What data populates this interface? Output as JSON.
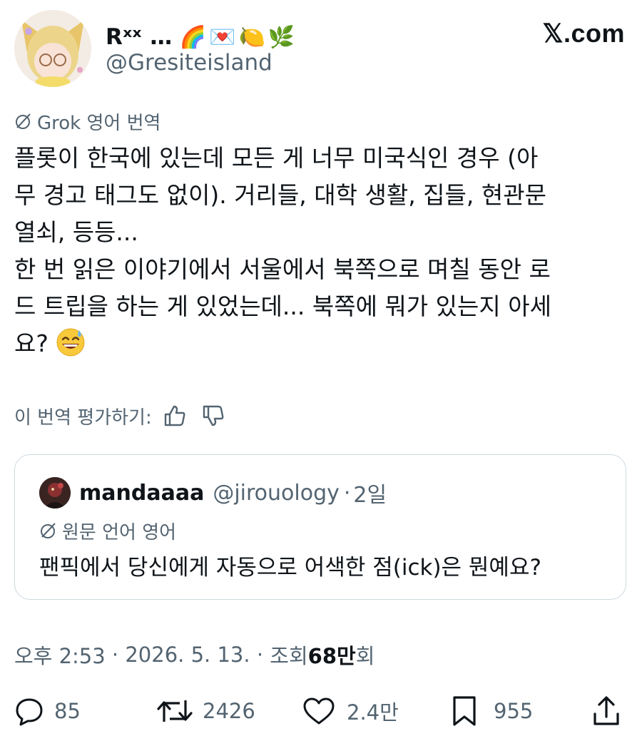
{
  "header": {
    "display_name": "Rˣˣ …",
    "emojis": "🌈💌🍋🌿",
    "handle": "@Gresiteisland",
    "site": "𝕏.com"
  },
  "translation": {
    "label": "Grok 영어 번역",
    "icon": "grok-icon"
  },
  "tweet": {
    "lines": [
      "플롯이 한국에 있는데 모든 게 너무 미국식인 경우 (아",
      "무 경고 태그도 없이). 거리들, 대학 생활, 집들, 현관문",
      "열쇠, 등등...",
      "한 번 읽은 이야기에서 서울에서 북쪽으로 며칠 동안 로",
      "드 트립을 하는 게 있었는데... 북쪽에 뭐가 있는지 아세",
      "요?"
    ],
    "emoji": "grinning-sweat-emoji"
  },
  "rating": {
    "label": "이 번역 평가하기:"
  },
  "quote": {
    "name": "mandaaaa",
    "handle": "@jirouology",
    "separator": "·",
    "time": "2일",
    "source_lang": "원문 언어 영어",
    "text": "팬픽에서 당신에게 자동으로 어색한 점(ick)은 뭔예요?"
  },
  "meta": {
    "time": "오후 2:53",
    "sep": " · ",
    "date": "2026. 5. 13.",
    "views_label": "조회",
    "views_count": "68만",
    "views_suffix": "회"
  },
  "actions": {
    "replies": "85",
    "retweets": "2426",
    "likes": "2.4만",
    "bookmarks": "955"
  },
  "colors": {
    "text": "#0f1419",
    "secondary": "#536471",
    "border": "#cfd9de"
  }
}
